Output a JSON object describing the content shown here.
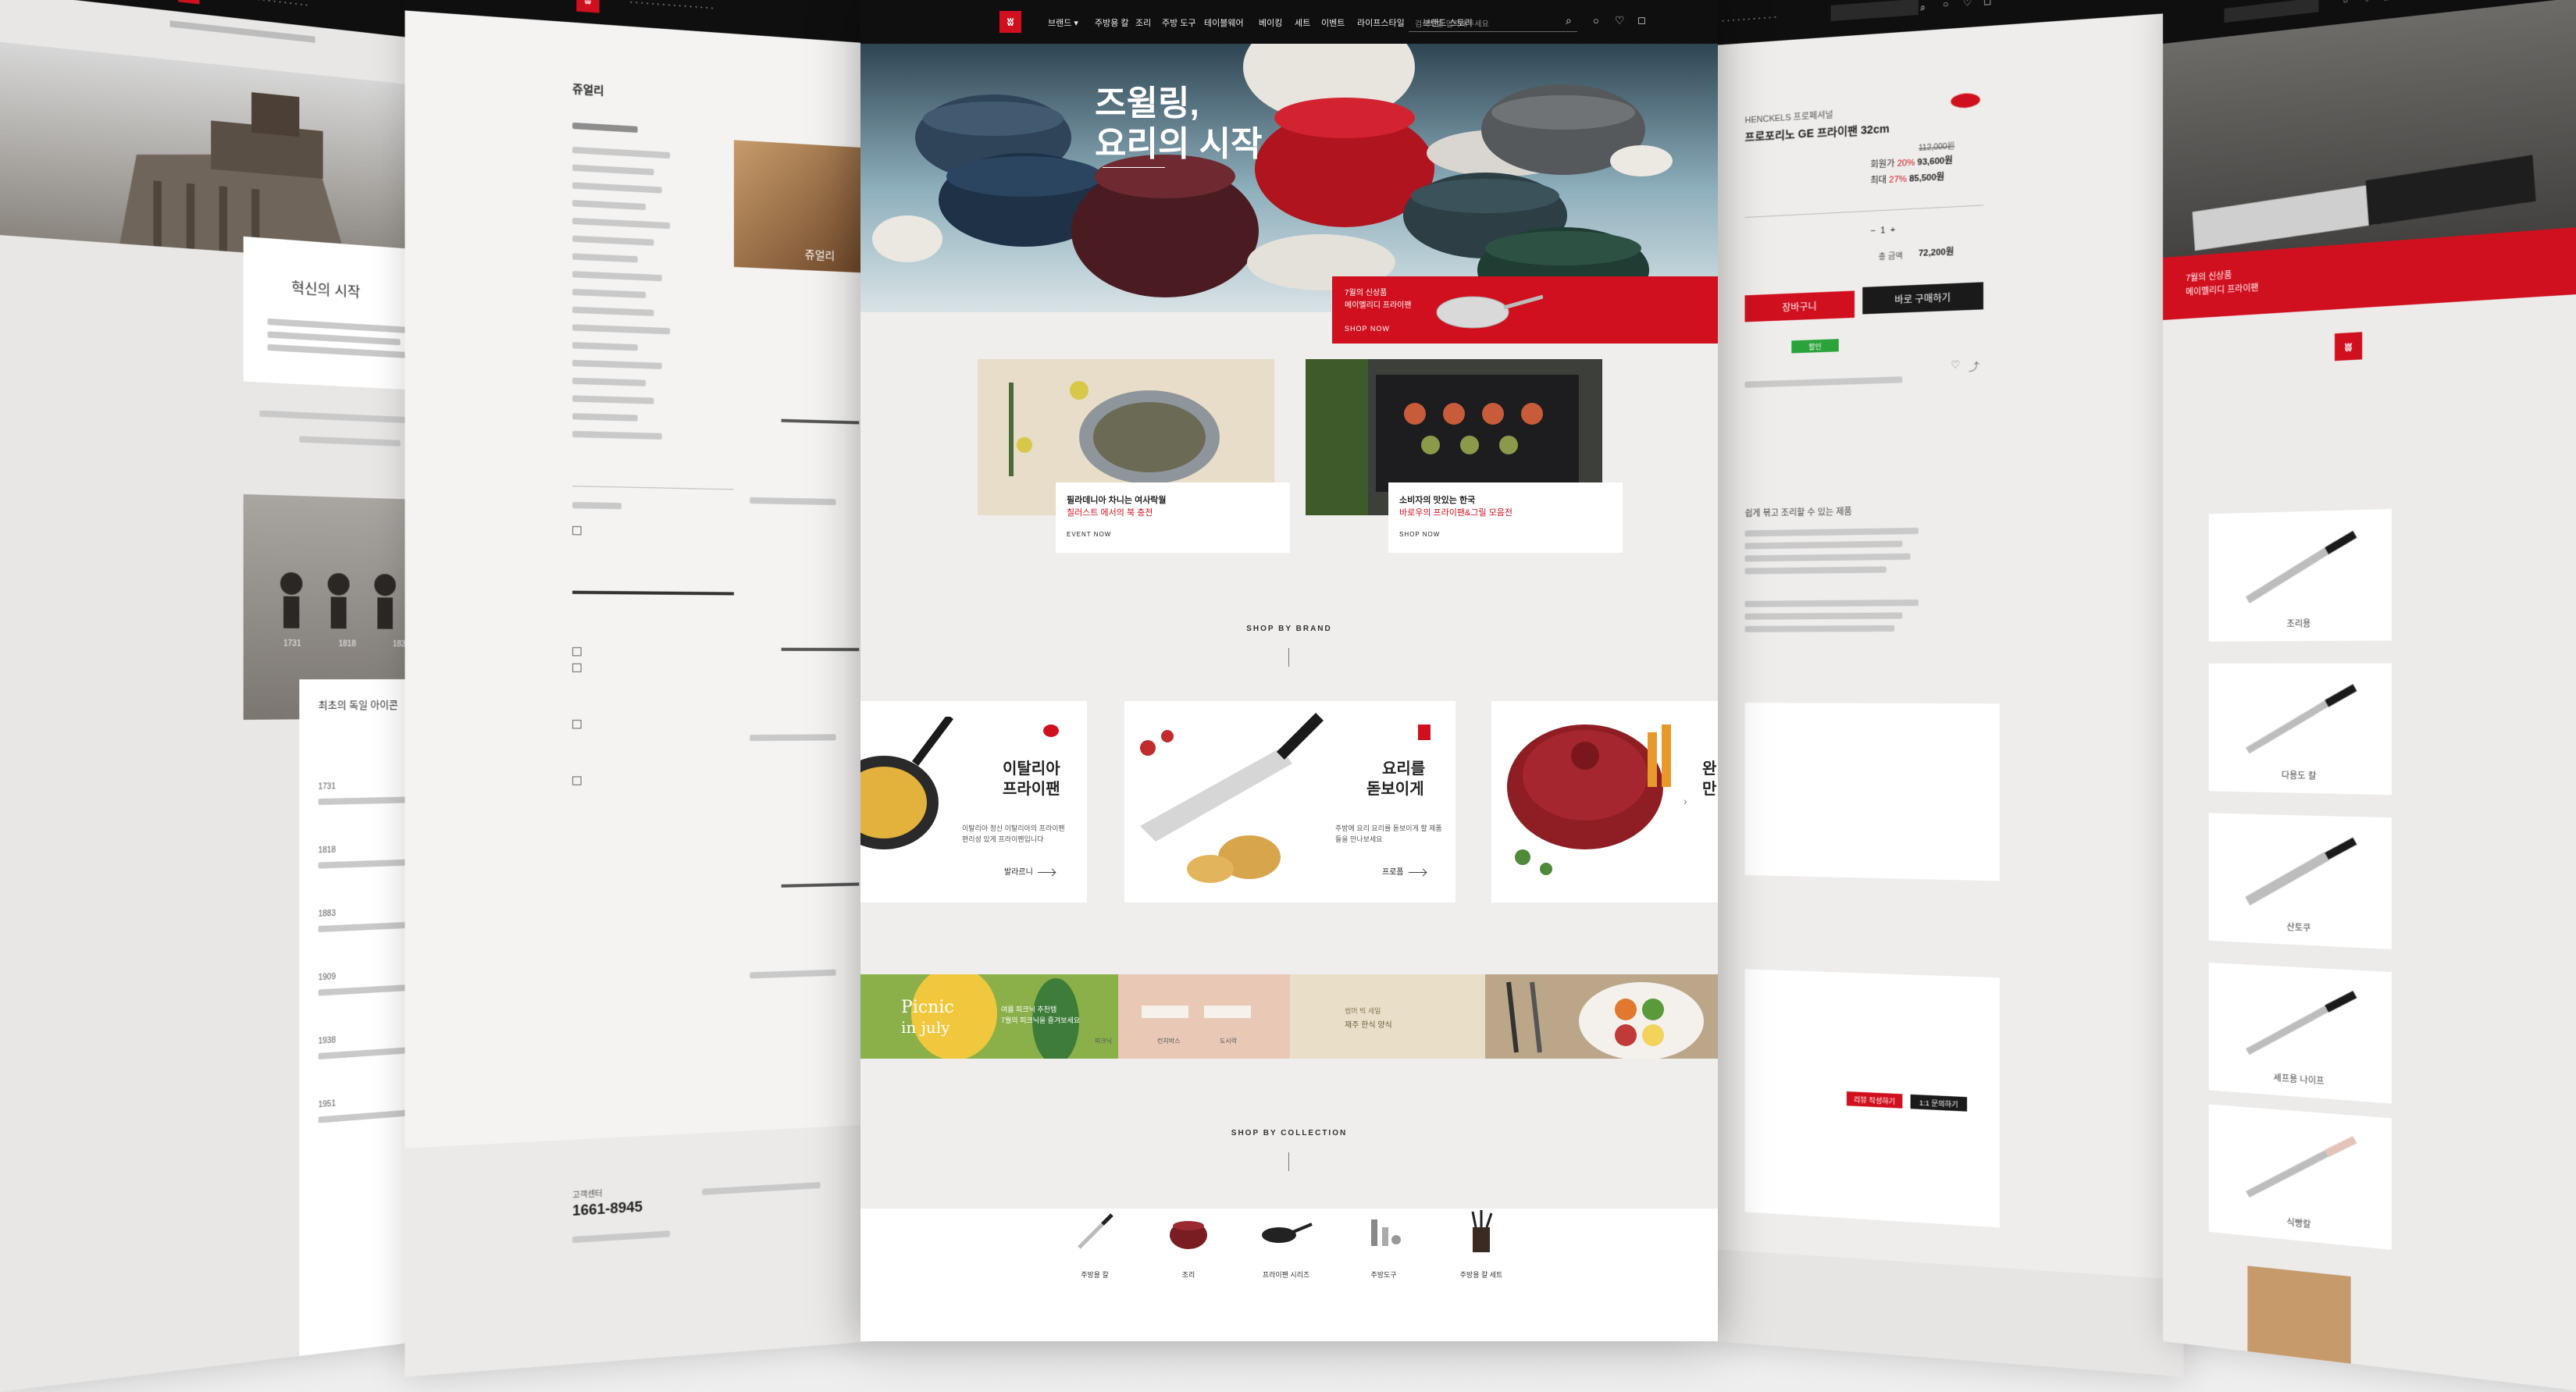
{
  "panel_far_left": {
    "title": "혁신의 시작",
    "timeline_heading": "최초의 독일 아이콘",
    "years": [
      "1731",
      "1818",
      "1883",
      "1909",
      "1938",
      "1951"
    ],
    "sub_years": [
      "1731",
      "1818",
      "1838"
    ]
  },
  "panel_left": {
    "category_title": "쥬얼리",
    "hotline_label": "고객센터",
    "hotline": "1661-8945",
    "hero_caption": "쥬얼리"
  },
  "main": {
    "nav": [
      "브랜드 ▾",
      "주방용 칼",
      "조리",
      "주방 도구",
      "테이블웨어",
      "베이킹",
      "세트",
      "이벤트",
      "라이프스타일",
      "브랜드 스토리"
    ],
    "search_placeholder": "검색어를 입력해주세요",
    "hero": {
      "title_line1": "즈윌링,",
      "title_line2": "요리의 시작",
      "promo_line1": "7월의 신상품",
      "promo_line2": "메이멜리디 프라이팬",
      "promo_cta": "SHOP NOW"
    },
    "events": [
      {
        "title": "필라데니아 차니는 여사락월",
        "subtitle": "칠러스트 에서의 북 충전",
        "cta": "EVENT NOW"
      },
      {
        "title": "소비자의 맛있는 한국",
        "subtitle": "바로우의 프라이팬&그릴 모음전",
        "cta": "SHOP NOW"
      }
    ],
    "brand_heading": "SHOP BY BRAND",
    "brands": [
      {
        "title_line1": "이탈리아",
        "title_line2": "프라이팬",
        "desc": "이탈리아 정신 이탈리아의 프라이팬 편리성 있게 프라이팬입니다",
        "cta": "발라르니"
      },
      {
        "title_line1": "요리를",
        "title_line2": "돋보이게",
        "desc": "주방에 요리 요리를 돋보이게 할 제품들을 만나보세요",
        "cta": "프로폼"
      },
      {
        "title_line1": "완",
        "title_line2": "만",
        "desc": "",
        "cta": ""
      }
    ],
    "banners": {
      "picnic_line1": "Picnic",
      "picnic_line2": "in july",
      "picnic_desc1": "여름 피크닉 추천템",
      "picnic_desc2": "7월의 피크닉을 즐겨보세요",
      "picnic_items": [
        "피크닉",
        "런치박스",
        "도시락"
      ],
      "summer_label": "썸머 빅 세일",
      "summer_title": "재주 한식 양식"
    },
    "collection_heading": "SHOP BY COLLECTION",
    "collections": [
      "주방용 칼",
      "조리",
      "프라이팬 시리즈",
      "주방도구",
      "주방용 칼 세트"
    ]
  },
  "product": {
    "brand_line": "HENCKELS 프로페셔널",
    "name": "프로포리노 GE 프라이팬 32cm",
    "list_price": "112,000원",
    "prices": [
      {
        "label": "회원가",
        "rate": "20%",
        "price": "93,600원"
      },
      {
        "label": "최대",
        "rate": "27%",
        "price": "85,500원"
      }
    ],
    "total_label": "총 금액",
    "total_price": "72,200원",
    "qty": "1",
    "cart_label": "장바구니",
    "buy_label": "바로 구매하기",
    "badge": "할인",
    "review_btn1": "리뷰 작성하기",
    "review_btn2": "1:1 문의하기",
    "desc_title": "쉽게 볶고 조리할 수 있는 제품"
  },
  "panel_far_right": {
    "promo_line1": "7월의 신상품",
    "promo_line2": "메이멜리디 프라이팬",
    "knives": [
      "조리용",
      "다용도 칼",
      "산토쿠",
      "셰프용 나이프",
      "식빵칼"
    ]
  },
  "colors": {
    "brand_red": "#d0101f",
    "topbar": "#0f0f10",
    "green": "#2aa33a"
  }
}
